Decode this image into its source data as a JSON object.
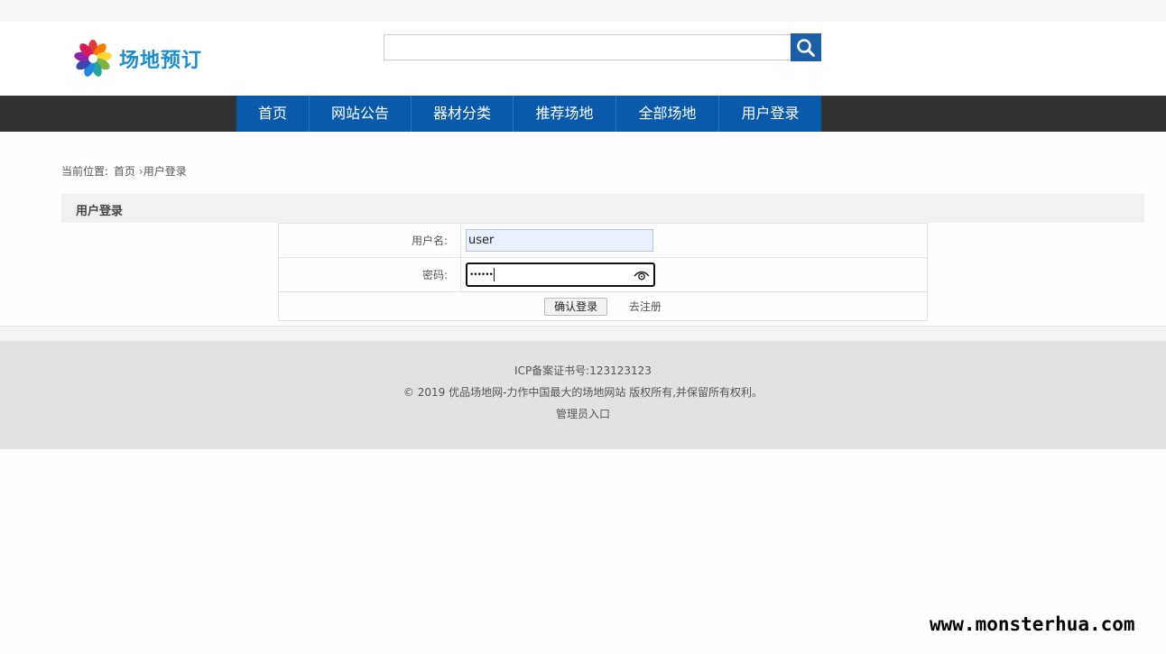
{
  "logo": {
    "text": "场地预订",
    "icon": "flower-logo-icon"
  },
  "search": {
    "placeholder": "",
    "value": "",
    "icon": "search-icon"
  },
  "nav": {
    "items": [
      "首页",
      "网站公告",
      "器材分类",
      "推荐场地",
      "全部场地",
      "用户登录"
    ]
  },
  "breadcrumb": {
    "prefix": "当前位置:",
    "home": "首页",
    "current": "用户登录"
  },
  "panel": {
    "title": "用户登录"
  },
  "form": {
    "username_label": "用户名:",
    "username_value": "user",
    "password_label": "密码:",
    "password_masked": "••••••",
    "submit_label": "确认登录",
    "register_label": "去注册"
  },
  "footer": {
    "icp": "ICP备案证书号:123123123",
    "copyright": "© 2019 优品场地网-力作中国最大的场地网站 版权所有,并保留所有权利。",
    "admin_link": "管理员入口"
  },
  "watermark": "www.monsterhua.com",
  "colors": {
    "nav_blue": "#0a5aab",
    "nav_bar": "#333333",
    "search_btn": "#1c5fa8",
    "logo_text": "#1a8fd0"
  }
}
